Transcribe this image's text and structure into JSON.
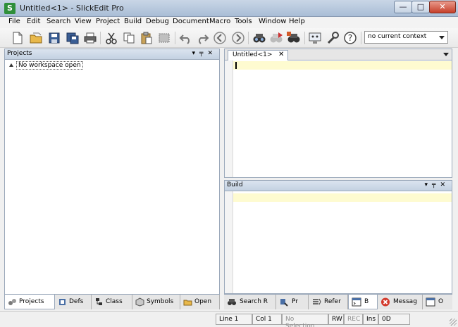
{
  "window": {
    "title": "Untitled<1> - SlickEdit Pro",
    "app_icon_letter": "S",
    "minimize": "—",
    "maximize": "□",
    "close": "✕"
  },
  "menu": [
    "File",
    "Edit",
    "Search",
    "View",
    "Project",
    "Build",
    "Debug",
    "Document",
    "Macro",
    "Tools",
    "Window",
    "Help"
  ],
  "toolbar": {
    "context": "no current context"
  },
  "projects_panel": {
    "title": "Projects",
    "tree_item": "No workspace open"
  },
  "left_tabs": [
    "Projects",
    "Defs",
    "Class",
    "Symbols",
    "Open"
  ],
  "editor": {
    "tab_label": "Untitled<1>",
    "tab_close": "✕"
  },
  "build_panel": {
    "title": "Build"
  },
  "right_tabs": [
    "Search R",
    "Pr",
    "Refer",
    "B",
    "Messag",
    "O"
  ],
  "status": {
    "line": "Line 1",
    "col": "Col 1",
    "selection": "No Selection",
    "rw": "RW",
    "rec": "REC",
    "ins": "Ins",
    "hex": "0D"
  },
  "colors": {
    "current_line": "#fefbd0",
    "panel_header": "#c3d1e2"
  }
}
